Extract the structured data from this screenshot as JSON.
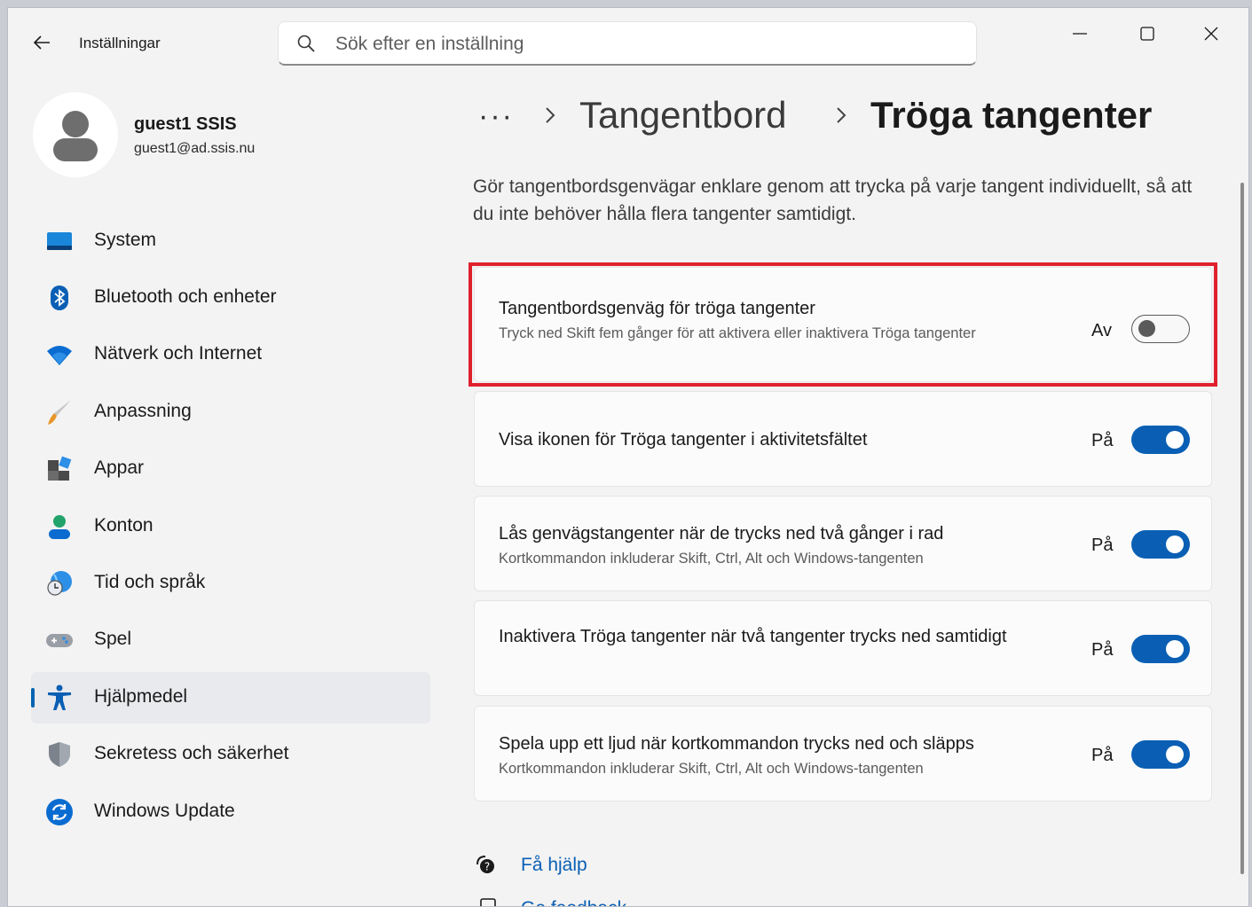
{
  "window": {
    "app_title": "Inställningar",
    "search_placeholder": "Sök efter en inställning"
  },
  "profile": {
    "name": "guest1 SSIS",
    "email": "guest1@ad.ssis.nu"
  },
  "sidebar": {
    "items": [
      {
        "label": "System",
        "icon": "system-icon"
      },
      {
        "label": "Bluetooth och enheter",
        "icon": "bluetooth-icon"
      },
      {
        "label": "Nätverk och Internet",
        "icon": "wifi-icon"
      },
      {
        "label": "Anpassning",
        "icon": "brush-icon"
      },
      {
        "label": "Appar",
        "icon": "apps-icon"
      },
      {
        "label": "Konton",
        "icon": "account-icon"
      },
      {
        "label": "Tid och språk",
        "icon": "globe-clock-icon"
      },
      {
        "label": "Spel",
        "icon": "gamepad-icon"
      },
      {
        "label": "Hjälpmedel",
        "icon": "accessibility-icon",
        "active": true
      },
      {
        "label": "Sekretess och säkerhet",
        "icon": "shield-icon"
      },
      {
        "label": "Windows Update",
        "icon": "update-icon"
      }
    ]
  },
  "breadcrumb": {
    "more": "···",
    "parent": "Tangentbord",
    "current": "Tröga tangenter"
  },
  "description": "Gör tangentbordsgenvägar enklare genom att trycka på varje tangent individuellt, så att du inte behöver hålla flera tangenter samtidigt.",
  "settings": [
    {
      "title": "Tangentbordsgenväg för tröga tangenter",
      "subtitle": "Tryck ned Skift fem gånger för att aktivera eller inaktivera Tröga tangenter",
      "state": "Av",
      "on": false
    },
    {
      "title": "Visa ikonen för Tröga tangenter i aktivitetsfältet",
      "subtitle": "",
      "state": "På",
      "on": true
    },
    {
      "title": "Lås genvägstangenter när de trycks ned två gånger i rad",
      "subtitle": "Kortkommandon inkluderar Skift, Ctrl, Alt och Windows-tangenten",
      "state": "På",
      "on": true
    },
    {
      "title": "Inaktivera Tröga tangenter när två tangenter trycks ned samtidigt",
      "subtitle": "",
      "state": "På",
      "on": true
    },
    {
      "title": "Spela upp ett ljud när kortkommandon trycks ned och släpps",
      "subtitle": "Kortkommandon inkluderar Skift, Ctrl, Alt och Windows-tangenten",
      "state": "På",
      "on": true
    }
  ],
  "footer": {
    "help": "Få hjälp",
    "feedback": "Ge feedback"
  },
  "colors": {
    "accent": "#0a5fb4",
    "highlight": "#e0212d"
  }
}
